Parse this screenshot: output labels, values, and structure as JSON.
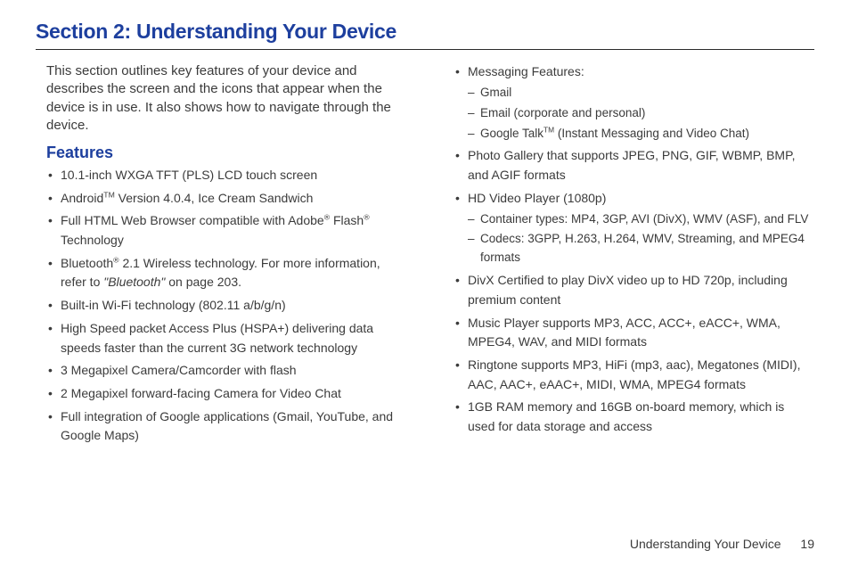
{
  "title": "Section 2: Understanding Your Device",
  "intro": "This section outlines key features of your device and describes the screen and the icons that appear when the device is in use. It also shows how to navigate through the device.",
  "features_heading": "Features",
  "col1": {
    "b1": "10.1-inch WXGA TFT (PLS) LCD touch screen",
    "b2_pre": "Android",
    "b2_tm": "TM",
    "b2_post": " Version 4.0.4, Ice Cream Sandwich",
    "b3_pre": "Full HTML Web Browser compatible with Adobe",
    "b3_reg1": "®",
    "b3_mid": " Flash",
    "b3_reg2": "®",
    "b3_post": " Technology",
    "b4_pre": "Bluetooth",
    "b4_reg": "®",
    "b4_mid": " 2.1 Wireless technology. For more information, refer to ",
    "b4_ital": "\"Bluetooth\" ",
    "b4_post": " on page 203.",
    "b5": "Built-in Wi-Fi technology (802.11 a/b/g/n)",
    "b6": "High Speed packet Access Plus (HSPA+) delivering data speeds faster than the current 3G network technology",
    "b7": "3 Megapixel Camera/Camcorder with flash",
    "b8": "2 Megapixel forward-facing Camera for Video Chat",
    "b9": "Full integration of Google applications (Gmail, YouTube, and Google Maps)"
  },
  "col2": {
    "msg_head": "Messaging Features:",
    "msg1": "Gmail",
    "msg2": "Email (corporate and personal)",
    "msg3_pre": "Google Talk",
    "msg3_tm": "TM",
    "msg3_post": " (Instant Messaging and Video Chat)",
    "photo": "Photo Gallery that supports JPEG, PNG, GIF, WBMP, BMP, and AGIF formats",
    "hd_head": "HD Video Player (1080p)",
    "hd1": "Container types: MP4, 3GP, AVI (DivX), WMV (ASF), and FLV",
    "hd2": "Codecs: 3GPP, H.263, H.264, WMV, Streaming, and MPEG4 formats",
    "divx": "DivX Certified to play DivX video up to HD 720p, including premium content",
    "music": "Music Player supports MP3, ACC, ACC+, eACC+, WMA, MPEG4, WAV, and MIDI formats",
    "ringtone": "Ringtone supports MP3, HiFi (mp3, aac), Megatones (MIDI), AAC, AAC+, eAAC+, MIDI, WMA, MPEG4 formats",
    "ram": "1GB RAM memory and 16GB on-board memory, which is used for data storage and access"
  },
  "footer_text": "Understanding Your Device",
  "footer_page": "19"
}
